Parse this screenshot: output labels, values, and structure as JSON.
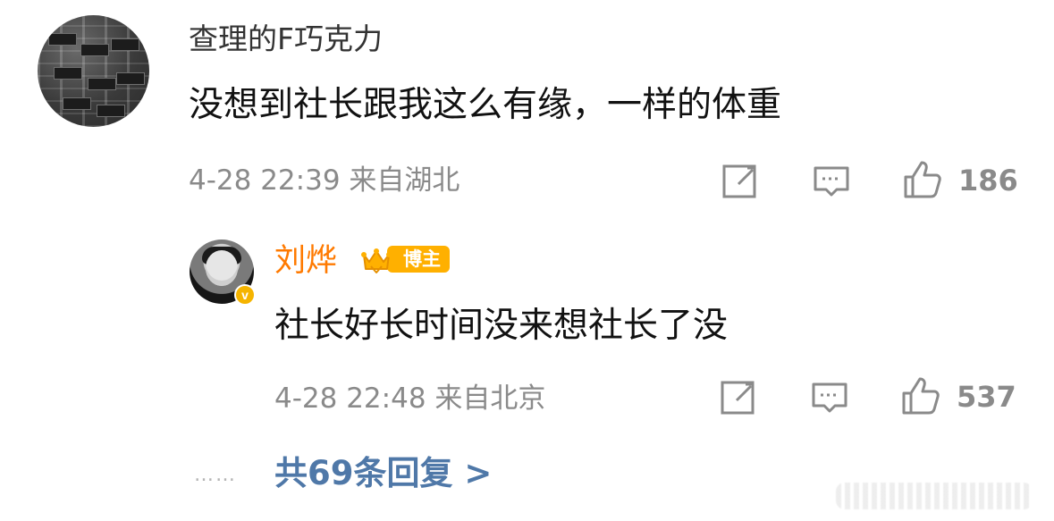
{
  "comment": {
    "username": "查理的F巧克力",
    "text": "没想到社长跟我这么有缘，一样的体重",
    "meta": "4-28 22:39 来自湖北",
    "likes": "186"
  },
  "reply": {
    "username": "刘烨",
    "badge_label": "博主",
    "verified_badge_text": "v",
    "text": "社长好长时间没来想社长了没",
    "meta": "4-28 22:48 来自北京",
    "likes": "537"
  },
  "footer": {
    "dots": "……",
    "more_replies": "共69条回复 >"
  },
  "colors": {
    "accent_orange": "#ff7a00",
    "badge_gold": "#ffb000",
    "link_blue": "#4f78a8",
    "meta_gray": "#8a8a8a",
    "icon_gray": "#8a8a8a"
  }
}
